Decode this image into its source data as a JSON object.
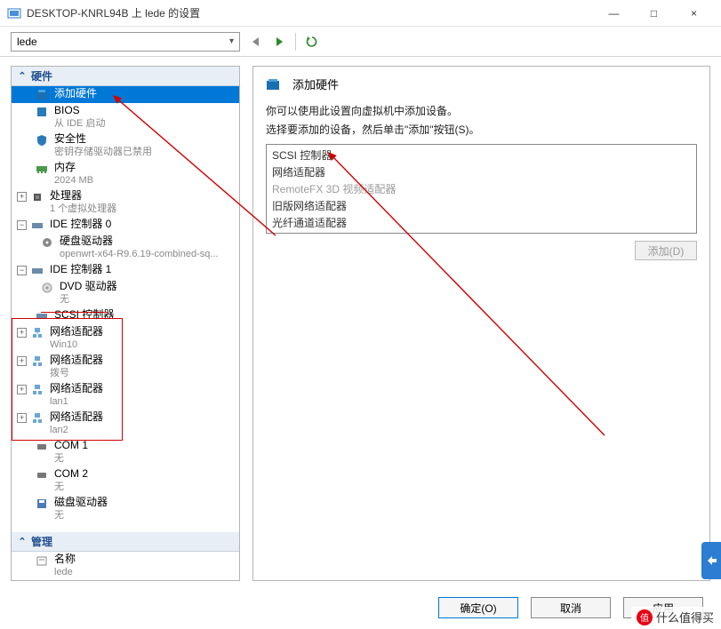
{
  "window": {
    "title": "DESKTOP-KNRL94B 上 lede 的设置",
    "minimize": "—",
    "maximize": "□",
    "close": "×"
  },
  "toolbar": {
    "combo_value": "lede"
  },
  "left": {
    "hardware_header": "硬件",
    "management_header": "管理",
    "items": {
      "add_hw": "添加硬件",
      "bios": "BIOS",
      "bios_sub": "从 IDE 启动",
      "security": "安全性",
      "security_sub": "密钥存储驱动器已禁用",
      "memory": "内存",
      "memory_sub": "2024 MB",
      "processor": "处理器",
      "processor_sub": "1 个虚拟处理器",
      "ide0": "IDE 控制器 0",
      "hdd": "硬盘驱动器",
      "hdd_sub": "openwrt-x64-R9.6.19-combined-sq...",
      "ide1": "IDE 控制器 1",
      "dvd": "DVD 驱动器",
      "dvd_sub": "无",
      "scsi": "SCSI 控制器",
      "net1": "网络适配器",
      "net1_sub": "Win10",
      "net2": "网络适配器",
      "net2_sub": "拨号",
      "net3": "网络适配器",
      "net3_sub": "lan1",
      "net4": "网络适配器",
      "net4_sub": "lan2",
      "com1": "COM 1",
      "com1_sub": "无",
      "com2": "COM 2",
      "com2_sub": "无",
      "floppy": "磁盘驱动器",
      "floppy_sub": "无",
      "name": "名称",
      "name_sub": "lede"
    }
  },
  "right": {
    "title": "添加硬件",
    "desc1": "你可以使用此设置向虚拟机中添加设备。",
    "desc2": "选择要添加的设备，然后单击\"添加\"按钮(S)。",
    "devices": {
      "scsi": "SCSI 控制器",
      "net": "网络适配器",
      "remotefx": "RemoteFX 3D 视频适配器",
      "legacy": "旧版网络适配器",
      "fiber": "光纤通道适配器"
    },
    "add_btn": "添加(D)"
  },
  "footer": {
    "ok": "确定(O)",
    "cancel": "取消",
    "apply": "应用"
  },
  "watermark": "什么值得买"
}
